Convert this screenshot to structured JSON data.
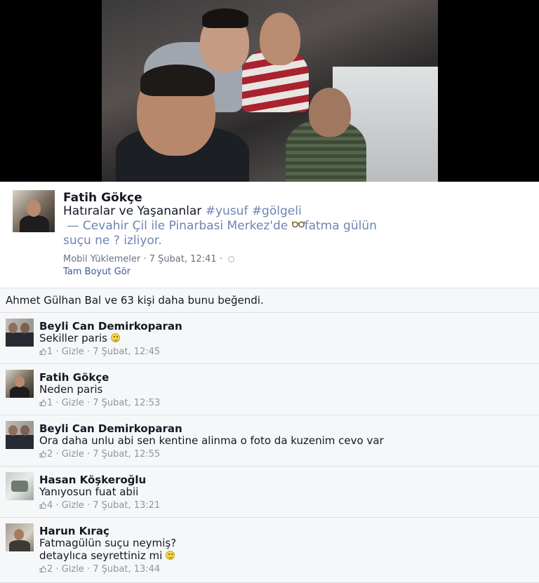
{
  "post": {
    "author": "Fatih Gökçe",
    "text_plain_1": "Hatıralar ve Yaşananlar ",
    "hashtag_1": "#yusuf",
    "hashtag_2": "#gölgeli",
    "dash": "— ",
    "tagged_person": "Cevahir Çil",
    "at_word": " ile ",
    "location": "Pinarbasi Merkez",
    "location_suffix": "'de ",
    "activity_link": "fatma gülün suçu ne ?",
    "activity_verb": " izliyor.",
    "album": "Mobil Yüklemeler",
    "separator": " · ",
    "timestamp": "7 Şubat, 12:41",
    "full_size_link": "Tam Boyut Gör"
  },
  "likes_summary": "Ahmet Gülhan Bal ve 63 kişi daha bunu beğendi.",
  "comments": [
    {
      "author": "Beyli Can Demirkoparan",
      "text": "Sekiller paris ",
      "smiley": true,
      "likes": "1",
      "hide": "Gizle",
      "time": "7 Şubat, 12:45"
    },
    {
      "author": "Fatih Gökçe",
      "text": "Neden paris",
      "smiley": false,
      "likes": "1",
      "hide": "Gizle",
      "time": "7 Şubat, 12:53"
    },
    {
      "author": "Beyli Can Demirkoparan",
      "text": "Ora daha unlu abi sen kentine alinma o foto da kuzenim cevo var",
      "smiley": false,
      "likes": "2",
      "hide": "Gizle",
      "time": "7 Şubat, 12:55"
    },
    {
      "author": "Hasan Köşkeroğlu",
      "text": "Yanıyosun fuat abii",
      "smiley": false,
      "likes": "4",
      "hide": "Gizle",
      "time": "7 Şubat, 13:21"
    },
    {
      "author": "Harun Kıraç",
      "text_line1": "Fatmagülün suçu neymiş?",
      "text_line2": "detaylıca seyrettiniz mi ",
      "smiley": true,
      "likes": "2",
      "hide": "Gizle",
      "time": "7 Şubat, 13:44"
    }
  ],
  "colors": {
    "link": "#3b5998",
    "hashtag": "#6d84b4",
    "meta": "#90949c",
    "row_bg": "#f6f7f8"
  }
}
